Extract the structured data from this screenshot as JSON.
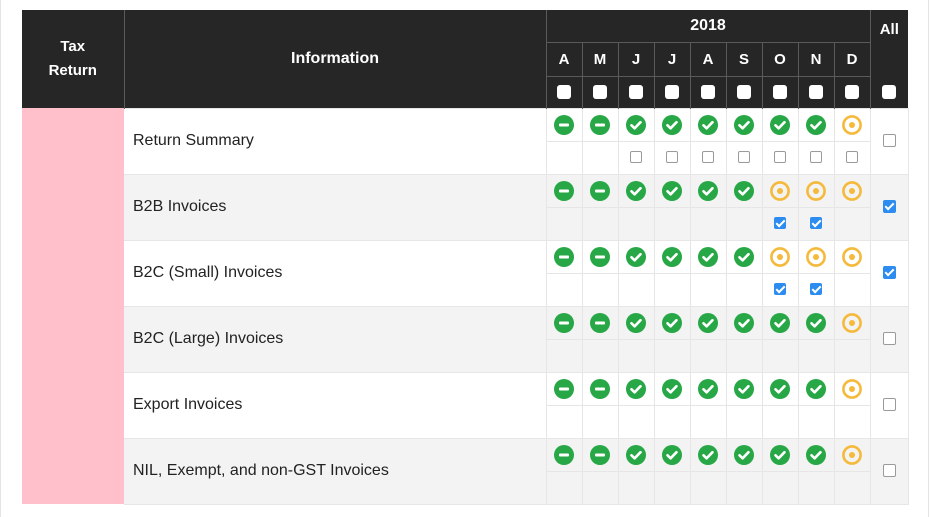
{
  "header": {
    "tax_return": "Tax Return",
    "information": "Information",
    "year": "2018",
    "all": "All",
    "months": [
      "A",
      "M",
      "J",
      "J",
      "A",
      "S",
      "O",
      "N",
      "D"
    ]
  },
  "colors": {
    "header_bg": "#262626",
    "pink": "#ffc0cb",
    "green": "#27a745",
    "yellow": "#f5b93b",
    "checkbox_blue": "#2d8cf0"
  },
  "rows": [
    {
      "label": "Return Summary",
      "status": [
        "minus",
        "minus",
        "check",
        "check",
        "check",
        "check",
        "check",
        "check",
        "dot"
      ],
      "month_checks": [
        null,
        null,
        false,
        false,
        false,
        false,
        false,
        false,
        false
      ],
      "all_checked": false
    },
    {
      "label": "B2B Invoices",
      "status": [
        "minus",
        "minus",
        "check",
        "check",
        "check",
        "check",
        "dot",
        "dot",
        "dot"
      ],
      "month_checks": [
        null,
        null,
        null,
        null,
        null,
        null,
        true,
        true,
        null
      ],
      "all_checked": true
    },
    {
      "label": "B2C (Small) Invoices",
      "status": [
        "minus",
        "minus",
        "check",
        "check",
        "check",
        "check",
        "dot",
        "dot",
        "dot"
      ],
      "month_checks": [
        null,
        null,
        null,
        null,
        null,
        null,
        true,
        true,
        null
      ],
      "all_checked": true
    },
    {
      "label": "B2C (Large) Invoices",
      "status": [
        "minus",
        "minus",
        "check",
        "check",
        "check",
        "check",
        "check",
        "check",
        "dot"
      ],
      "month_checks": [
        null,
        null,
        null,
        null,
        null,
        null,
        null,
        null,
        null
      ],
      "all_checked": false
    },
    {
      "label": "Export Invoices",
      "status": [
        "minus",
        "minus",
        "check",
        "check",
        "check",
        "check",
        "check",
        "check",
        "dot"
      ],
      "month_checks": [
        null,
        null,
        null,
        null,
        null,
        null,
        null,
        null,
        null
      ],
      "all_checked": false
    },
    {
      "label": "NIL, Exempt, and non-GST Invoices",
      "status": [
        "minus",
        "minus",
        "check",
        "check",
        "check",
        "check",
        "check",
        "check",
        "dot"
      ],
      "month_checks": [
        null,
        null,
        null,
        null,
        null,
        null,
        null,
        null,
        null
      ],
      "all_checked": false
    }
  ]
}
